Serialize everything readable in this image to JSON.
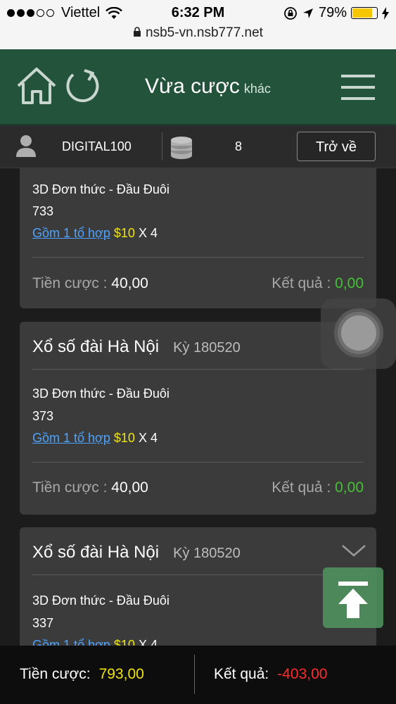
{
  "status_bar": {
    "carrier": "Viettel",
    "time": "6:32 PM",
    "battery": "79%",
    "battery_level": 0.79,
    "url": "nsb5-vn.nsb777.net"
  },
  "header": {
    "title": "Vừa cược",
    "subtitle": "khác"
  },
  "info_bar": {
    "username": "DIGITAL100",
    "count": "8",
    "back_label": "Trở về"
  },
  "bets": [
    {
      "lottery": "",
      "period": "",
      "bet_type": "3D Đơn thức - Đầu Đuôi",
      "number": "733",
      "combo_link": "Gồm 1 tổ hợp",
      "unit": "$10",
      "multiplier": "X 4",
      "stake_label": "Tiền cược",
      "stake": "40,00",
      "result_label": "Kết quả",
      "result": "0,00"
    },
    {
      "lottery": "Xổ số đài Hà Nội",
      "period": "Kỳ 180520",
      "bet_type": "3D Đơn thức - Đầu Đuôi",
      "number": "373",
      "combo_link": "Gồm 1 tổ hợp",
      "unit": "$10",
      "multiplier": "X 4",
      "stake_label": "Tiền cược",
      "stake": "40,00",
      "result_label": "Kết quả",
      "result": "0,00"
    },
    {
      "lottery": "Xổ số đài Hà Nội",
      "period": "Kỳ 180520",
      "bet_type": "3D Đơn thức - Đầu Đuôi",
      "number": "337",
      "combo_link": "Gồm 1 tổ hợp",
      "unit": "$10",
      "multiplier": "X 4"
    }
  ],
  "footer": {
    "stake_label": "Tiền cược:",
    "stake_total": "793,00",
    "result_label": "Kết quả:",
    "result_total": "-403,00"
  },
  "colors": {
    "header_bg": "#23533b",
    "link": "#4da3ff",
    "amount_yellow": "#f0e30a",
    "result_green": "#44c233",
    "loss_red": "#ff2a2a"
  }
}
